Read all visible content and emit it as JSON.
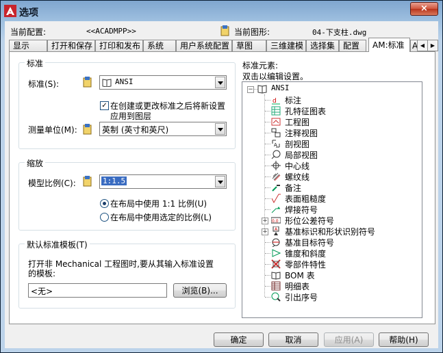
{
  "window": {
    "title": "选项",
    "close_label": "×"
  },
  "header": {
    "profile_label": "当前配置:",
    "profile_value": "<<ACADMPP>>",
    "drawing_label": "当前图形:",
    "drawing_value": "04-下支柱.dwg"
  },
  "tabs": [
    {
      "label": "显示"
    },
    {
      "label": "打开和保存"
    },
    {
      "label": "打印和发布"
    },
    {
      "label": "系统"
    },
    {
      "label": "用户系统配置"
    },
    {
      "label": "草图"
    },
    {
      "label": "三维建模"
    },
    {
      "label": "选择集"
    },
    {
      "label": "配置"
    },
    {
      "label": "AM:标准"
    },
    {
      "label": "A"
    }
  ],
  "active_tab": "AM:标准",
  "standard_group": {
    "title": "标准",
    "standard_label": "标准(S):",
    "standard_value": "ANSI",
    "checkbox_checked": true,
    "checkbox_line1": "在创建或更改标准之后将新设置",
    "checkbox_line2": "应用到图层",
    "units_label": "测量单位(M):",
    "units_value": "英制 (英寸和英尺)"
  },
  "scale_group": {
    "title": "缩放",
    "scale_label": "模型比例(C):",
    "scale_value": "1:1.5",
    "radio1_label": "在布局中使用 1:1 比例(U)",
    "radio1_selected": true,
    "radio2_label": "在布局中使用选定的比例(L)",
    "radio2_selected": false
  },
  "template_group": {
    "title": "默认标准模板(T)",
    "desc_line1": "打开非 Mechanical 工程图时,要从其输入标准设置",
    "desc_line2": "的模板:",
    "template_value": "<无>",
    "browse_label": "浏览(B)..."
  },
  "elements_panel": {
    "title": "标准元素:",
    "hint": "双击以编辑设置。",
    "root": "ANSI",
    "items": [
      {
        "label": "标注",
        "icon": "dimension-icon",
        "expandable": false
      },
      {
        "label": "孔特征图表",
        "icon": "hole-chart-icon",
        "expandable": false
      },
      {
        "label": "工程图",
        "icon": "drawing-icon",
        "expandable": false
      },
      {
        "label": "注释视图",
        "icon": "annotation-view-icon",
        "expandable": false
      },
      {
        "label": "剖视图",
        "icon": "section-view-icon",
        "expandable": false
      },
      {
        "label": "局部视图",
        "icon": "detail-view-icon",
        "expandable": false
      },
      {
        "label": "中心线",
        "icon": "centerline-icon",
        "expandable": false
      },
      {
        "label": "螺纹线",
        "icon": "thread-icon",
        "expandable": false
      },
      {
        "label": "备注",
        "icon": "note-icon",
        "expandable": false
      },
      {
        "label": "表面粗糙度",
        "icon": "surface-texture-icon",
        "expandable": false
      },
      {
        "label": "焊接符号",
        "icon": "weld-symbol-icon",
        "expandable": false
      },
      {
        "label": "形位公差符号",
        "icon": "fcf-icon",
        "expandable": true
      },
      {
        "label": "基准标识和形状识别符号",
        "icon": "datum-id-icon",
        "expandable": true
      },
      {
        "label": "基准目标符号",
        "icon": "datum-target-icon",
        "expandable": false
      },
      {
        "label": "锥度和斜度",
        "icon": "taper-slope-icon",
        "expandable": false
      },
      {
        "label": "零部件特性",
        "icon": "part-properties-icon",
        "expandable": false
      },
      {
        "label": "BOM 表",
        "icon": "bom-icon",
        "expandable": false
      },
      {
        "label": "明细表",
        "icon": "parts-list-icon",
        "expandable": false
      },
      {
        "label": "引出序号",
        "icon": "balloon-icon",
        "expandable": false
      }
    ]
  },
  "buttons": {
    "ok": "确定",
    "cancel": "取消",
    "apply": "应用(A)",
    "help": "帮助(H)"
  }
}
